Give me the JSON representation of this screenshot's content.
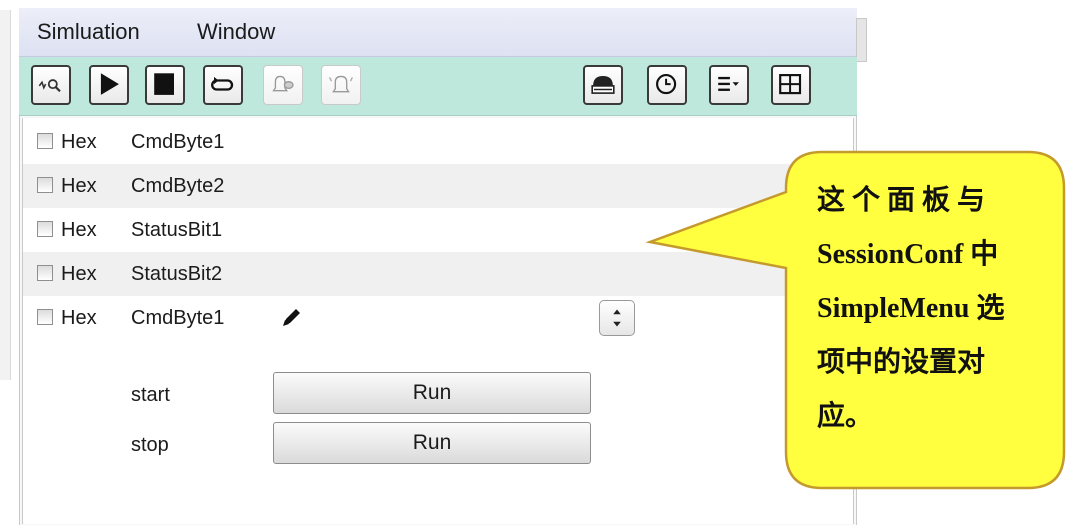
{
  "menu": {
    "simulation": "Simluation",
    "window": "Window"
  },
  "toolbar": {
    "left": [
      {
        "icon": "find-signal-icon",
        "enabled": true
      },
      {
        "icon": "play-icon",
        "enabled": true
      },
      {
        "icon": "stop-icon",
        "enabled": true
      },
      {
        "icon": "loop-icon",
        "enabled": true
      },
      {
        "icon": "alarm-message-icon",
        "enabled": false
      },
      {
        "icon": "alarm-bell-icon",
        "enabled": false
      }
    ],
    "right": [
      {
        "icon": "device-icon"
      },
      {
        "icon": "clock-icon"
      },
      {
        "icon": "list-menu-icon"
      },
      {
        "icon": "grid-icon"
      }
    ]
  },
  "rows": [
    {
      "hex": "Hex",
      "name": "CmdByte1"
    },
    {
      "hex": "Hex",
      "name": "CmdByte2"
    },
    {
      "hex": "Hex",
      "name": "StatusBit1"
    },
    {
      "hex": "Hex",
      "name": "StatusBit2"
    },
    {
      "hex": "Hex",
      "name": "CmdByte1"
    }
  ],
  "commands": [
    {
      "label": "start",
      "button": "Run"
    },
    {
      "label": "stop",
      "button": "Run"
    }
  ],
  "callout": {
    "line1": "这 个 面 板 与",
    "line2": "SessionConf 中",
    "line3": "SimpleMenu 选",
    "line4": "项中的设置对",
    "line5": "应。",
    "fill": "#ffff40",
    "stroke": "#c59a2c"
  }
}
